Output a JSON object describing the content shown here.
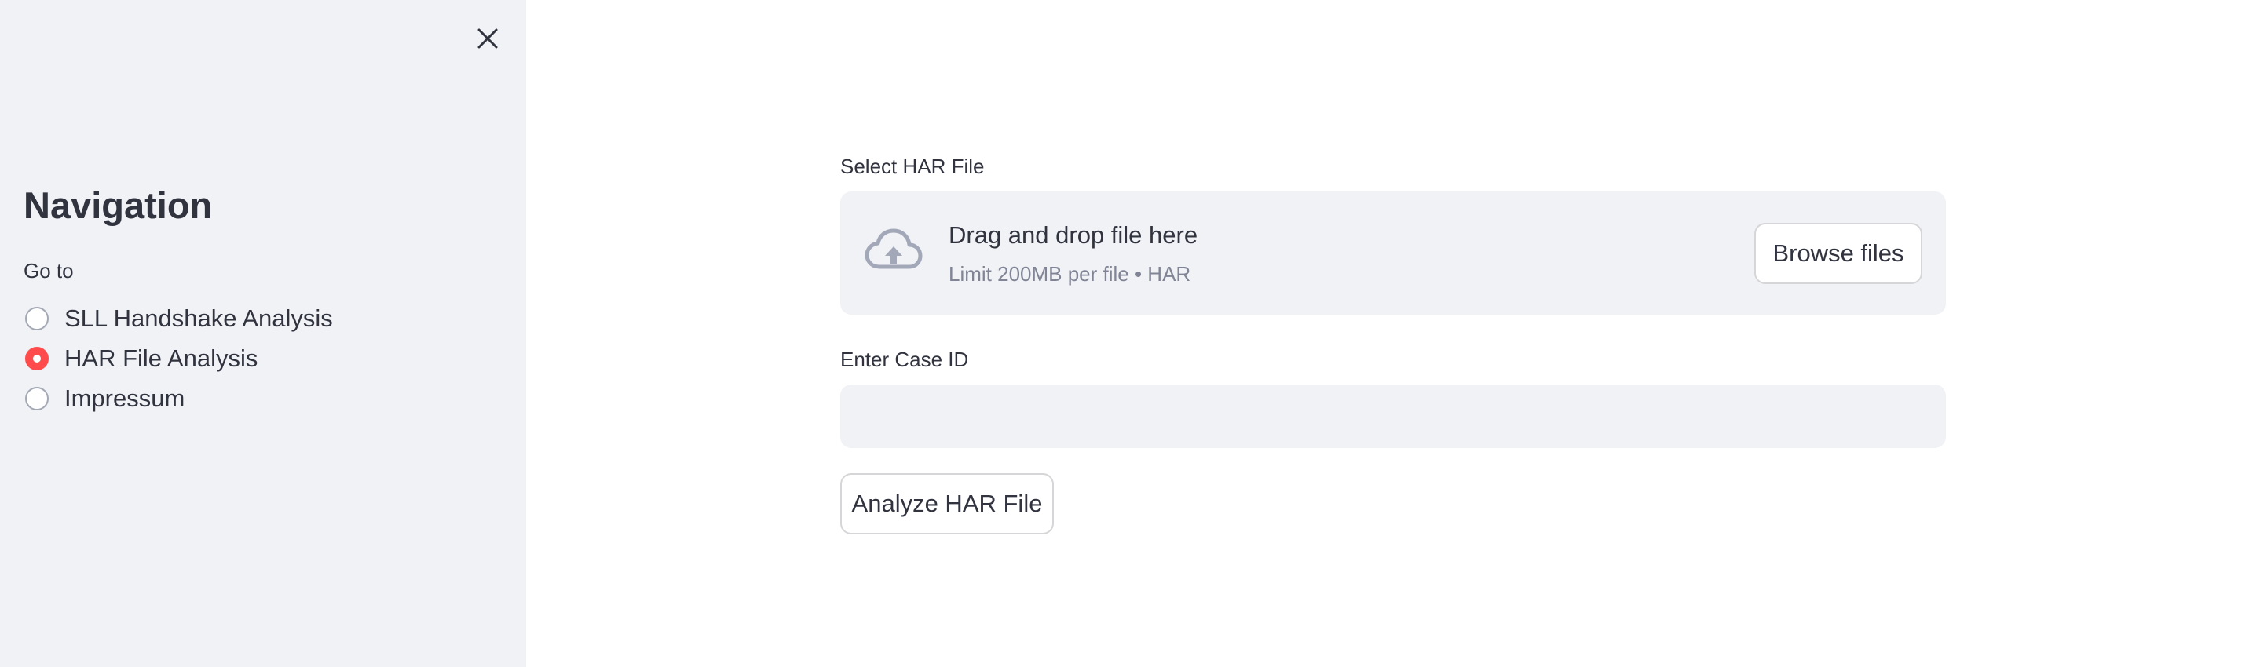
{
  "sidebar": {
    "title": "Navigation",
    "goto_label": "Go to",
    "options": [
      {
        "label": "SLL Handshake Analysis",
        "selected": false
      },
      {
        "label": "HAR File Analysis",
        "selected": true
      },
      {
        "label": "Impressum",
        "selected": false
      }
    ],
    "close_icon": "close-icon"
  },
  "main": {
    "file_label": "Select HAR File",
    "dropzone": {
      "icon": "cloud-upload-icon",
      "title": "Drag and drop file here",
      "limit": "Limit 200MB per file • HAR",
      "browse_label": "Browse files"
    },
    "case_label": "Enter Case ID",
    "case_value": "",
    "case_placeholder": "",
    "analyze_label": "Analyze HAR File"
  },
  "colors": {
    "sidebar_bg": "#f0f2f6",
    "accent": "#ff4b4b",
    "text": "#31333f",
    "muted_text": "#808495"
  }
}
